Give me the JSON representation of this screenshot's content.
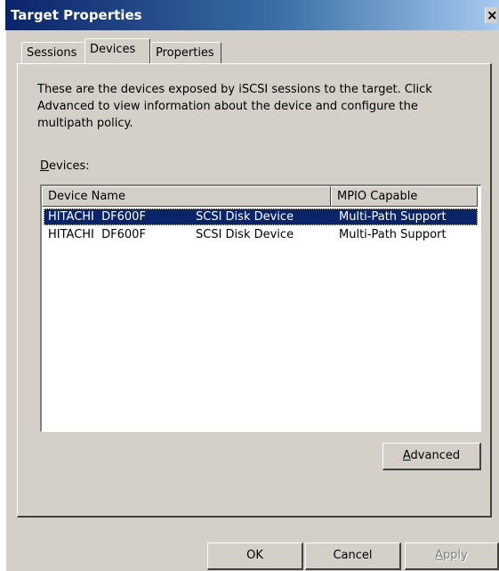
{
  "window": {
    "title": "Target Properties",
    "close_glyph": "×"
  },
  "tabs": [
    {
      "label": "Sessions",
      "active": false
    },
    {
      "label": "Devices",
      "active": true
    },
    {
      "label": "Properties",
      "active": false
    }
  ],
  "devices_tab": {
    "description": "These are the devices exposed by iSCSI sessions to the target. Click Advanced to view information about the device and configure the multipath policy.",
    "devices_label_mnemonic": "D",
    "devices_label_rest": "evices:",
    "columns": [
      "Device Name",
      "MPIO Capable"
    ],
    "rows": [
      {
        "name": "HITACHI  DF600F",
        "type": "SCSI Disk Device",
        "mpio": "Multi-Path Support",
        "selected": true
      },
      {
        "name": "HITACHI  DF600F",
        "type": "SCSI Disk Device",
        "mpio": "Multi-Path Support",
        "selected": false
      }
    ],
    "advanced_mnemonic": "A",
    "advanced_rest": "dvanced"
  },
  "footer": {
    "ok_label": "OK",
    "cancel_label": "Cancel",
    "apply_mnemonic": "A",
    "apply_rest": "pply"
  },
  "colors": {
    "titlebar_start": "#0a246a",
    "titlebar_end": "#a6caf0",
    "dialog_face": "#d4d0c8",
    "selection": "#0a246a"
  }
}
